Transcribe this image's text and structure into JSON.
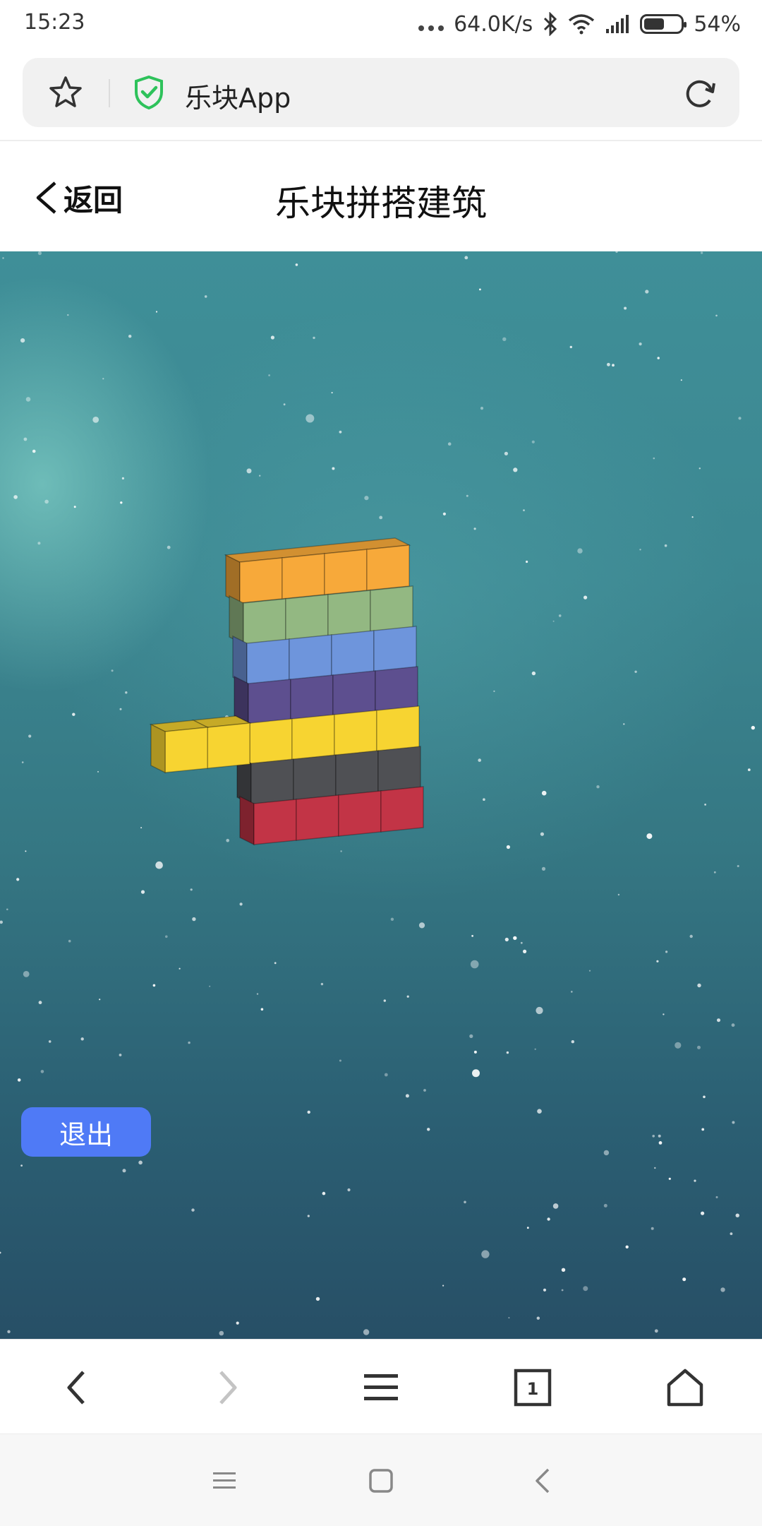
{
  "status_bar": {
    "time": "15:23",
    "network_speed": "64.0K/s",
    "battery_percent": "54%",
    "battery_level": 0.54,
    "icons": [
      "more-dots-icon",
      "bluetooth-icon",
      "wifi-icon",
      "signal-icon",
      "battery-icon"
    ]
  },
  "browser": {
    "url_text": "乐块App",
    "icons": [
      "star-icon",
      "shield-check-icon",
      "reload-icon"
    ],
    "shield_color": "#2ec25b"
  },
  "header": {
    "back_label": "返回",
    "title": "乐块拼搭建筑"
  },
  "scene": {
    "exit_label": "退出",
    "exit_color": "#4f7af6",
    "block_rows_top_to_bottom": [
      {
        "color_name": "orange",
        "color": "#f7a93a"
      },
      {
        "color_name": "green",
        "color": "#93b882"
      },
      {
        "color_name": "blue",
        "color": "#6e95dc"
      },
      {
        "color_name": "purple",
        "color": "#5d4f8f"
      },
      {
        "color_name": "yellow",
        "color": "#f7d431"
      },
      {
        "color_name": "dark-gray",
        "color": "#4f5054"
      },
      {
        "color_name": "red",
        "color": "#c23446"
      }
    ]
  },
  "bottom_toolbar": {
    "tab_count": "1",
    "icons": [
      "back-arrow-icon",
      "forward-arrow-icon",
      "menu-icon",
      "tabs-icon",
      "home-icon"
    ]
  },
  "system_nav": {
    "icons": [
      "recent-apps-icon",
      "home-square-icon",
      "back-triangle-icon"
    ]
  }
}
